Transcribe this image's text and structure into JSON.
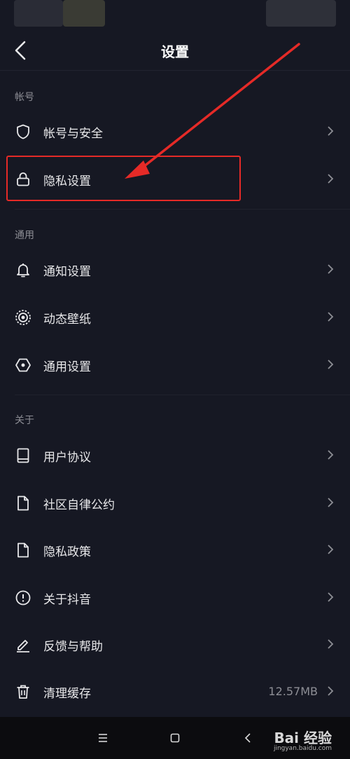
{
  "header": {
    "title": "设置",
    "back_icon": "chevron-left-icon"
  },
  "sections": {
    "account": {
      "label": "帐号",
      "items": [
        {
          "label": "帐号与安全",
          "icon": "shield-icon"
        },
        {
          "label": "隐私设置",
          "icon": "lock-icon"
        }
      ]
    },
    "general": {
      "label": "通用",
      "items": [
        {
          "label": "通知设置",
          "icon": "bell-icon"
        },
        {
          "label": "动态壁纸",
          "icon": "live-wallpaper-icon"
        },
        {
          "label": "通用设置",
          "icon": "hexagon-settings-icon"
        }
      ]
    },
    "about": {
      "label": "关于",
      "items": [
        {
          "label": "用户协议",
          "icon": "book-icon"
        },
        {
          "label": "社区自律公约",
          "icon": "document-icon"
        },
        {
          "label": "隐私政策",
          "icon": "document-icon"
        },
        {
          "label": "关于抖音",
          "icon": "info-icon"
        },
        {
          "label": "反馈与帮助",
          "icon": "edit-icon"
        },
        {
          "label": "清理缓存",
          "icon": "trash-icon",
          "value": "12.57MB"
        }
      ]
    }
  },
  "annotation": {
    "color": "#e52a27",
    "target": "隐私设置"
  },
  "watermark": {
    "brand": "Bai 经验",
    "site": "jingyan.baidu.com"
  },
  "nav": {
    "menu_icon": "menu-icon",
    "home_icon": "square-home-icon",
    "back_icon": "triangle-back-icon"
  },
  "colors": {
    "background": "#161823",
    "text": "#e8e8ea",
    "muted": "#8d8e95",
    "accent": "#e52a27"
  }
}
